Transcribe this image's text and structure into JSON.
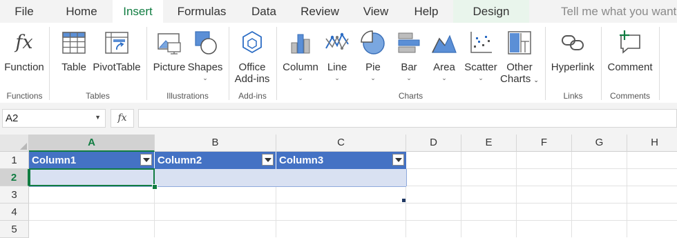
{
  "tabs": [
    {
      "label": "File"
    },
    {
      "label": "Home"
    },
    {
      "label": "Insert"
    },
    {
      "label": "Formulas"
    },
    {
      "label": "Data"
    },
    {
      "label": "Review"
    },
    {
      "label": "View"
    },
    {
      "label": "Help"
    },
    {
      "label": "Design"
    }
  ],
  "active_tab": "Insert",
  "tell_me": "Tell me what you want",
  "ribbon": {
    "function": "Function",
    "table": "Table",
    "pivottable": "PivotTable",
    "picture": "Picture",
    "shapes": "Shapes",
    "addins_line1": "Office",
    "addins_line2": "Add-ins",
    "column": "Column",
    "line": "Line",
    "pie": "Pie",
    "bar": "Bar",
    "area": "Area",
    "scatter": "Scatter",
    "other_line1": "Other",
    "other_line2": "Charts",
    "hyperlink": "Hyperlink",
    "comment": "Comment"
  },
  "groups": {
    "functions": "Functions",
    "tables": "Tables",
    "illustrations": "Illustrations",
    "addins": "Add-ins",
    "charts": "Charts",
    "links": "Links",
    "comments": "Comments"
  },
  "formula_bar": {
    "name_box": "A2",
    "fx": "fx",
    "value": ""
  },
  "columns": [
    "A",
    "B",
    "C",
    "D",
    "E",
    "F",
    "G",
    "H"
  ],
  "rows": [
    "1",
    "2",
    "3",
    "4",
    "5"
  ],
  "table_headers": [
    "Column1",
    "Column2",
    "Column3"
  ],
  "selected_cell": "A2",
  "colors": {
    "accent": "#107c41",
    "table_header": "#4472c4",
    "table_band": "#d9e1f2"
  }
}
